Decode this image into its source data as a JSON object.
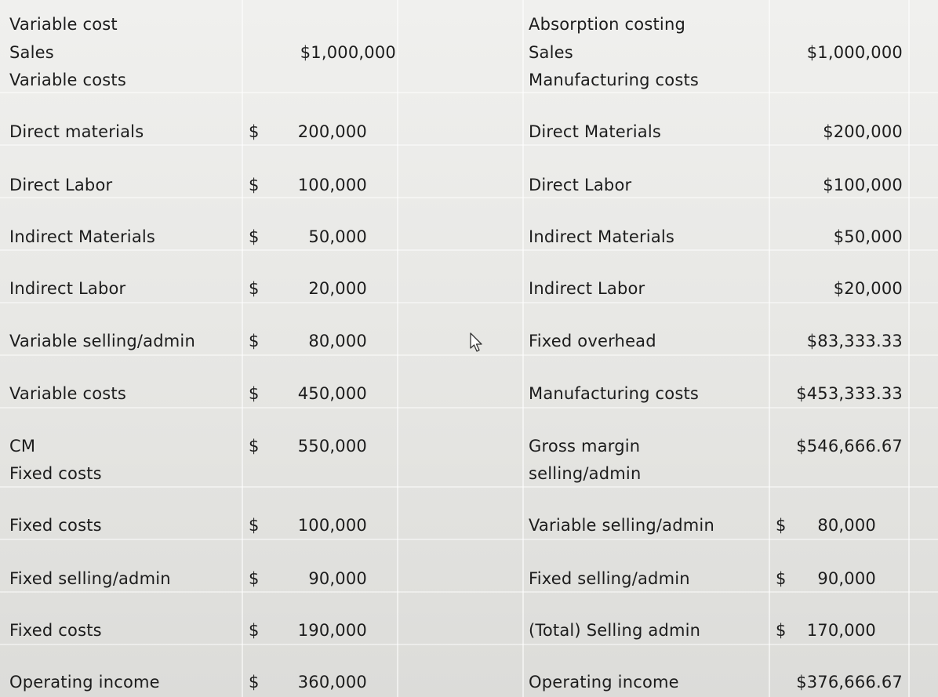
{
  "left": {
    "title": "Variable cost",
    "sales_label": "Sales",
    "sales_value": "$1,000,000",
    "variable_costs_header": "Variable costs",
    "rows": [
      {
        "label": "Direct materials",
        "dollar": "$",
        "value": "200,000"
      },
      {
        "label": "Direct Labor",
        "dollar": "$",
        "value": "100,000"
      },
      {
        "label": "Indirect Materials",
        "dollar": "$",
        "value": "50,000"
      },
      {
        "label": "Indirect Labor",
        "dollar": "$",
        "value": "20,000"
      },
      {
        "label": "Variable selling/admin",
        "dollar": "$",
        "value": "80,000"
      },
      {
        "label": "Variable costs",
        "dollar": "$",
        "value": "450,000"
      },
      {
        "label": "CM",
        "dollar": "$",
        "value": "550,000"
      }
    ],
    "fixed_costs_header": "Fixed costs",
    "fixed_rows": [
      {
        "label": "Fixed costs",
        "dollar": "$",
        "value": "100,000"
      },
      {
        "label": "Fixed selling/admin",
        "dollar": "$",
        "value": "90,000"
      },
      {
        "label": "Fixed costs",
        "dollar": "$",
        "value": "190,000"
      },
      {
        "label": "Operating income",
        "dollar": "$",
        "value": "360,000"
      }
    ]
  },
  "right": {
    "title": "Absorption costing",
    "sales_label": "Sales",
    "sales_value": "$1,000,000",
    "manufacturing_header": "Manufacturing costs",
    "rows": [
      {
        "label": "Direct Materials",
        "value": "$200,000"
      },
      {
        "label": "Direct Labor",
        "value": "$100,000"
      },
      {
        "label": "Indirect Materials",
        "value": "$50,000"
      },
      {
        "label": "Indirect Labor",
        "value": "$20,000"
      },
      {
        "label": "Fixed overhead",
        "value": "$83,333.33"
      },
      {
        "label": "Manufacturing costs",
        "value": "$453,333.33"
      },
      {
        "label": "Gross margin",
        "value": "$546,666.67"
      }
    ],
    "selling_header": "selling/admin",
    "selling_rows": [
      {
        "label": "Variable selling/admin",
        "dollar": "$",
        "value": "80,000"
      },
      {
        "label": "Fixed selling/admin",
        "dollar": "$",
        "value": "90,000"
      },
      {
        "label": "(Total) Selling admin",
        "dollar": "$",
        "value": "170,000"
      }
    ],
    "operating_income_label": "Operating income",
    "operating_income_value": "$376,666.67"
  }
}
